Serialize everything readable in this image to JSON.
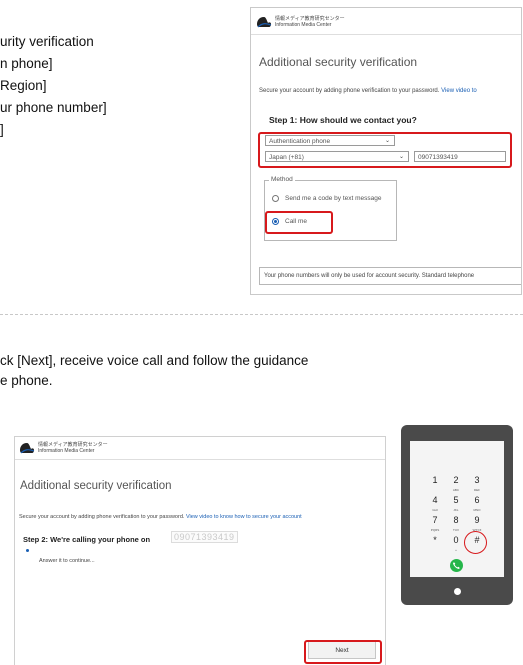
{
  "instructions": {
    "lines": [
      "urity verification",
      "n phone]",
      "Region]",
      "ur phone number]",
      "]"
    ],
    "step_text_line1": "ck [Next], receive voice call and follow the guidance",
    "step_text_line2": "e phone."
  },
  "top_screenshot": {
    "logo_text_jp": "情報メディア教育研究センター",
    "logo_text_en": "Information Media Center",
    "title": "Additional security verification",
    "description": "Secure your account by adding phone verification to your password.",
    "description_link": "View video to",
    "step_title": "Step 1: How should we contact you?",
    "contact_method": "Authentication phone",
    "country": "Japan (+81)",
    "phone_number": "09071393419",
    "method_legend": "Method",
    "method_options": [
      "Send me a code by text message",
      "Call me"
    ],
    "selected_method": "Call me",
    "footer_note": "Your phone numbers will only be used for account security. Standard telephone"
  },
  "bottom_screenshot": {
    "logo_text_jp": "情報メディア教育研究センター",
    "logo_text_en": "Information Media Center",
    "title": "Additional security verification",
    "description": "Secure your account by adding phone verification to your password.",
    "description_link": "View video to know how to secure your account",
    "step_title": "Step 2: We're calling your phone on",
    "masked_phone": "09071393419",
    "status": "Answer it to continue...",
    "next_button": "Next"
  },
  "phone_keypad": {
    "keys": [
      {
        "digit": "1",
        "sub": ""
      },
      {
        "digit": "2",
        "sub": "ABC"
      },
      {
        "digit": "3",
        "sub": "DEF"
      },
      {
        "digit": "4",
        "sub": "GHI"
      },
      {
        "digit": "5",
        "sub": "JKL"
      },
      {
        "digit": "6",
        "sub": "MNO"
      },
      {
        "digit": "7",
        "sub": "PQRS"
      },
      {
        "digit": "8",
        "sub": "TUV"
      },
      {
        "digit": "9",
        "sub": "WXYZ"
      },
      {
        "digit": "*",
        "sub": ""
      },
      {
        "digit": "0",
        "sub": "+"
      },
      {
        "digit": "#",
        "sub": ""
      }
    ],
    "highlighted_key": "#",
    "call_icon": "phone-icon"
  },
  "colors": {
    "highlight_red": "#d7191c",
    "link_blue": "#1a5fb4",
    "call_green": "#25b64a",
    "phone_body": "#4a4a4a"
  }
}
